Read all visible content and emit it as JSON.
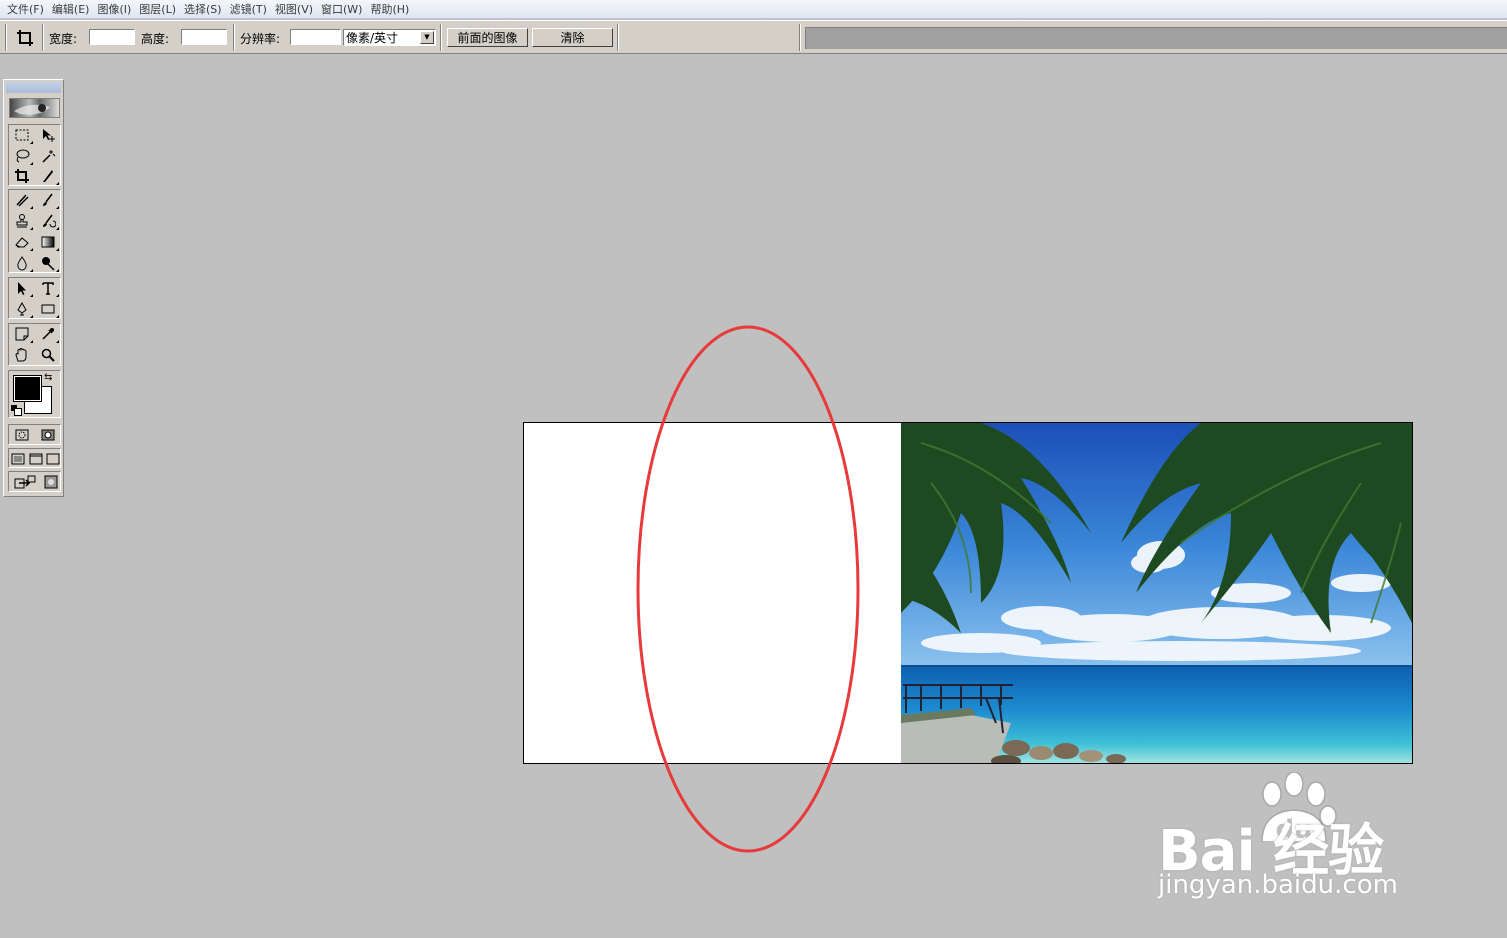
{
  "menubar": {
    "items": [
      "文件(F)",
      "编辑(E)",
      "图像(I)",
      "图层(L)",
      "选择(S)",
      "滤镜(T)",
      "视图(V)",
      "窗口(W)",
      "帮助(H)"
    ]
  },
  "options_bar": {
    "width_label": "宽度:",
    "width_value": "",
    "height_label": "高度:",
    "height_value": "",
    "resolution_label": "分辨率:",
    "resolution_value": "",
    "unit_selected": "像素/英寸",
    "front_image_button": "前面的图像",
    "clear_button": "清除"
  },
  "toolbox": {
    "colors": {
      "foreground": "#000000",
      "background": "#ffffff"
    }
  },
  "annotation": {
    "color": "#e83a3a"
  },
  "watermark": {
    "brand": "Bai  经验",
    "brand_paw_text": "du",
    "url": "jingyan.baidu.com"
  }
}
